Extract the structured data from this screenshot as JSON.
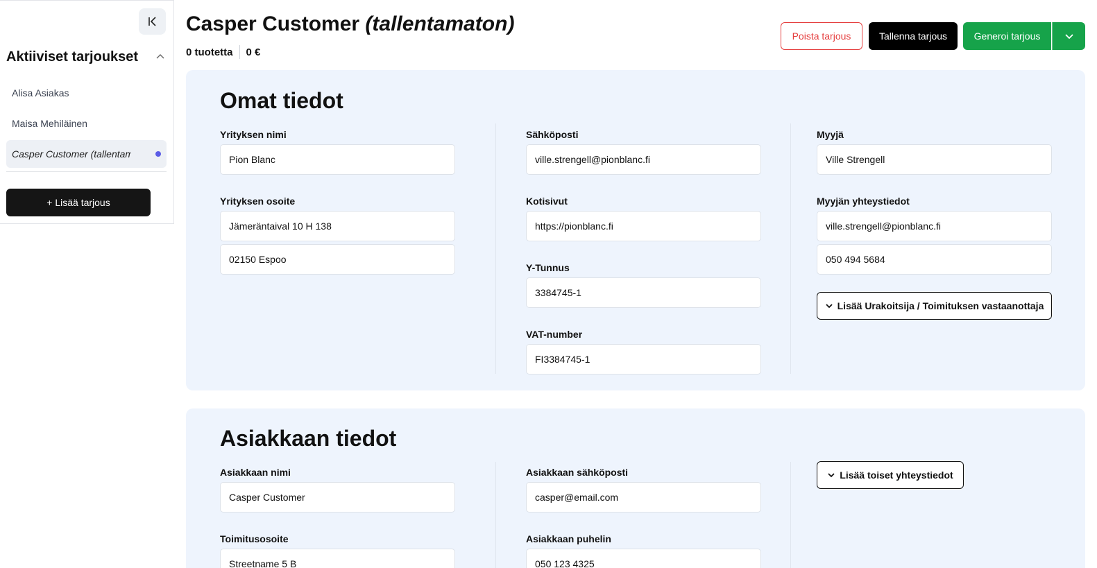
{
  "sidebar": {
    "heading": "Aktiiviset tarjoukset",
    "items": [
      {
        "label": "Alisa Asiakas"
      },
      {
        "label": "Maisa Mehiläinen"
      },
      {
        "label": "Casper Customer (tallentamaton)"
      }
    ],
    "add_button": "+ Lisää tarjous"
  },
  "header": {
    "title": "Casper Customer",
    "title_status": "(tallentamaton)",
    "product_count": "0 tuotetta",
    "total": "0 €",
    "delete_button": "Poista tarjous",
    "save_button": "Tallenna tarjous",
    "generate_button": "Generoi tarjous"
  },
  "own_info": {
    "heading": "Omat tiedot",
    "company_name_label": "Yrityksen nimi",
    "company_name": "Pion Blanc",
    "company_address_label": "Yrityksen osoite",
    "address_line1": "Jämeräntaival 10 H 138",
    "address_line2": "02150 Espoo",
    "email_label": "Sähköposti",
    "email": "ville.strengell@pionblanc.fi",
    "website_label": "Kotisivut",
    "website": "https://pionblanc.fi",
    "business_id_label": "Y-Tunnus",
    "business_id": "3384745-1",
    "vat_label": "VAT-number",
    "vat": "FI3384745-1",
    "seller_label": "Myyjä",
    "seller": "Ville Strengell",
    "seller_contact_label": "Myyjän yhteystiedot",
    "seller_email": "ville.strengell@pionblanc.fi",
    "seller_phone": "050 494 5684",
    "add_contractor_button": "Lisää Urakoitsija / Toimituksen vastaanottaja"
  },
  "customer_info": {
    "heading": "Asiakkaan tiedot",
    "name_label": "Asiakkaan nimi",
    "name": "Casper Customer",
    "email_label": "Asiakkaan sähköposti",
    "email": "casper@email.com",
    "delivery_address_label": "Toimitusosoite",
    "delivery_address": "Streetname 5 B",
    "phone_label": "Asiakkaan puhelin",
    "phone": "050 123 4325",
    "add_other_contacts_button": "Lisää toiset yhteystiedot"
  }
}
